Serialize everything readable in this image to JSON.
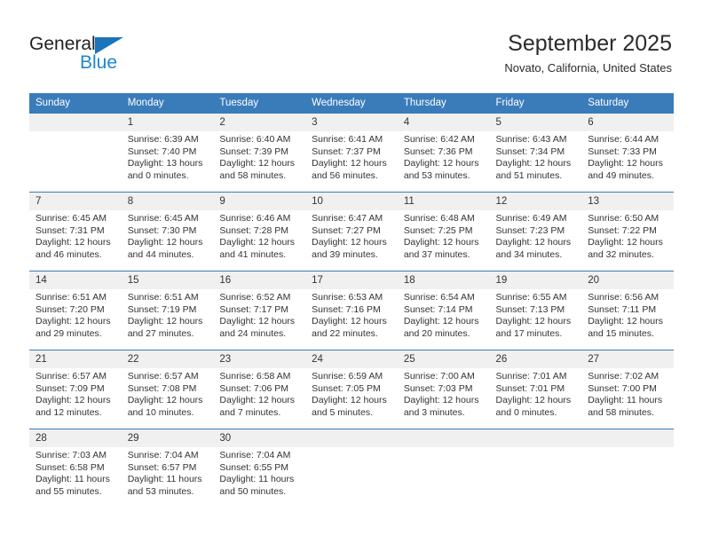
{
  "brand": {
    "name_top": "General",
    "name_bottom": "Blue",
    "color_primary": "#1b75bb",
    "color_secondary": "#1b87d2"
  },
  "header": {
    "title": "September 2025",
    "subtitle": "Novato, California, United States"
  },
  "theme": {
    "header_row_bg": "#3a7cba",
    "daynum_bg": "#f0f0f0",
    "text": "#333333"
  },
  "weekday_headers": [
    "Sunday",
    "Monday",
    "Tuesday",
    "Wednesday",
    "Thursday",
    "Friday",
    "Saturday"
  ],
  "weeks": [
    [
      {
        "day": "",
        "empty": true,
        "sunrise": "",
        "sunset": "",
        "daylight1": "",
        "daylight2": ""
      },
      {
        "day": "1",
        "sunrise": "Sunrise: 6:39 AM",
        "sunset": "Sunset: 7:40 PM",
        "daylight1": "Daylight: 13 hours",
        "daylight2": "and 0 minutes."
      },
      {
        "day": "2",
        "sunrise": "Sunrise: 6:40 AM",
        "sunset": "Sunset: 7:39 PM",
        "daylight1": "Daylight: 12 hours",
        "daylight2": "and 58 minutes."
      },
      {
        "day": "3",
        "sunrise": "Sunrise: 6:41 AM",
        "sunset": "Sunset: 7:37 PM",
        "daylight1": "Daylight: 12 hours",
        "daylight2": "and 56 minutes."
      },
      {
        "day": "4",
        "sunrise": "Sunrise: 6:42 AM",
        "sunset": "Sunset: 7:36 PM",
        "daylight1": "Daylight: 12 hours",
        "daylight2": "and 53 minutes."
      },
      {
        "day": "5",
        "sunrise": "Sunrise: 6:43 AM",
        "sunset": "Sunset: 7:34 PM",
        "daylight1": "Daylight: 12 hours",
        "daylight2": "and 51 minutes."
      },
      {
        "day": "6",
        "sunrise": "Sunrise: 6:44 AM",
        "sunset": "Sunset: 7:33 PM",
        "daylight1": "Daylight: 12 hours",
        "daylight2": "and 49 minutes."
      }
    ],
    [
      {
        "day": "7",
        "sunrise": "Sunrise: 6:45 AM",
        "sunset": "Sunset: 7:31 PM",
        "daylight1": "Daylight: 12 hours",
        "daylight2": "and 46 minutes."
      },
      {
        "day": "8",
        "sunrise": "Sunrise: 6:45 AM",
        "sunset": "Sunset: 7:30 PM",
        "daylight1": "Daylight: 12 hours",
        "daylight2": "and 44 minutes."
      },
      {
        "day": "9",
        "sunrise": "Sunrise: 6:46 AM",
        "sunset": "Sunset: 7:28 PM",
        "daylight1": "Daylight: 12 hours",
        "daylight2": "and 41 minutes."
      },
      {
        "day": "10",
        "sunrise": "Sunrise: 6:47 AM",
        "sunset": "Sunset: 7:27 PM",
        "daylight1": "Daylight: 12 hours",
        "daylight2": "and 39 minutes."
      },
      {
        "day": "11",
        "sunrise": "Sunrise: 6:48 AM",
        "sunset": "Sunset: 7:25 PM",
        "daylight1": "Daylight: 12 hours",
        "daylight2": "and 37 minutes."
      },
      {
        "day": "12",
        "sunrise": "Sunrise: 6:49 AM",
        "sunset": "Sunset: 7:23 PM",
        "daylight1": "Daylight: 12 hours",
        "daylight2": "and 34 minutes."
      },
      {
        "day": "13",
        "sunrise": "Sunrise: 6:50 AM",
        "sunset": "Sunset: 7:22 PM",
        "daylight1": "Daylight: 12 hours",
        "daylight2": "and 32 minutes."
      }
    ],
    [
      {
        "day": "14",
        "sunrise": "Sunrise: 6:51 AM",
        "sunset": "Sunset: 7:20 PM",
        "daylight1": "Daylight: 12 hours",
        "daylight2": "and 29 minutes."
      },
      {
        "day": "15",
        "sunrise": "Sunrise: 6:51 AM",
        "sunset": "Sunset: 7:19 PM",
        "daylight1": "Daylight: 12 hours",
        "daylight2": "and 27 minutes."
      },
      {
        "day": "16",
        "sunrise": "Sunrise: 6:52 AM",
        "sunset": "Sunset: 7:17 PM",
        "daylight1": "Daylight: 12 hours",
        "daylight2": "and 24 minutes."
      },
      {
        "day": "17",
        "sunrise": "Sunrise: 6:53 AM",
        "sunset": "Sunset: 7:16 PM",
        "daylight1": "Daylight: 12 hours",
        "daylight2": "and 22 minutes."
      },
      {
        "day": "18",
        "sunrise": "Sunrise: 6:54 AM",
        "sunset": "Sunset: 7:14 PM",
        "daylight1": "Daylight: 12 hours",
        "daylight2": "and 20 minutes."
      },
      {
        "day": "19",
        "sunrise": "Sunrise: 6:55 AM",
        "sunset": "Sunset: 7:13 PM",
        "daylight1": "Daylight: 12 hours",
        "daylight2": "and 17 minutes."
      },
      {
        "day": "20",
        "sunrise": "Sunrise: 6:56 AM",
        "sunset": "Sunset: 7:11 PM",
        "daylight1": "Daylight: 12 hours",
        "daylight2": "and 15 minutes."
      }
    ],
    [
      {
        "day": "21",
        "sunrise": "Sunrise: 6:57 AM",
        "sunset": "Sunset: 7:09 PM",
        "daylight1": "Daylight: 12 hours",
        "daylight2": "and 12 minutes."
      },
      {
        "day": "22",
        "sunrise": "Sunrise: 6:57 AM",
        "sunset": "Sunset: 7:08 PM",
        "daylight1": "Daylight: 12 hours",
        "daylight2": "and 10 minutes."
      },
      {
        "day": "23",
        "sunrise": "Sunrise: 6:58 AM",
        "sunset": "Sunset: 7:06 PM",
        "daylight1": "Daylight: 12 hours",
        "daylight2": "and 7 minutes."
      },
      {
        "day": "24",
        "sunrise": "Sunrise: 6:59 AM",
        "sunset": "Sunset: 7:05 PM",
        "daylight1": "Daylight: 12 hours",
        "daylight2": "and 5 minutes."
      },
      {
        "day": "25",
        "sunrise": "Sunrise: 7:00 AM",
        "sunset": "Sunset: 7:03 PM",
        "daylight1": "Daylight: 12 hours",
        "daylight2": "and 3 minutes."
      },
      {
        "day": "26",
        "sunrise": "Sunrise: 7:01 AM",
        "sunset": "Sunset: 7:01 PM",
        "daylight1": "Daylight: 12 hours",
        "daylight2": "and 0 minutes."
      },
      {
        "day": "27",
        "sunrise": "Sunrise: 7:02 AM",
        "sunset": "Sunset: 7:00 PM",
        "daylight1": "Daylight: 11 hours",
        "daylight2": "and 58 minutes."
      }
    ],
    [
      {
        "day": "28",
        "sunrise": "Sunrise: 7:03 AM",
        "sunset": "Sunset: 6:58 PM",
        "daylight1": "Daylight: 11 hours",
        "daylight2": "and 55 minutes."
      },
      {
        "day": "29",
        "sunrise": "Sunrise: 7:04 AM",
        "sunset": "Sunset: 6:57 PM",
        "daylight1": "Daylight: 11 hours",
        "daylight2": "and 53 minutes."
      },
      {
        "day": "30",
        "sunrise": "Sunrise: 7:04 AM",
        "sunset": "Sunset: 6:55 PM",
        "daylight1": "Daylight: 11 hours",
        "daylight2": "and 50 minutes."
      },
      {
        "day": "",
        "empty": true,
        "sunrise": "",
        "sunset": "",
        "daylight1": "",
        "daylight2": ""
      },
      {
        "day": "",
        "empty": true,
        "sunrise": "",
        "sunset": "",
        "daylight1": "",
        "daylight2": ""
      },
      {
        "day": "",
        "empty": true,
        "sunrise": "",
        "sunset": "",
        "daylight1": "",
        "daylight2": ""
      },
      {
        "day": "",
        "empty": true,
        "sunrise": "",
        "sunset": "",
        "daylight1": "",
        "daylight2": ""
      }
    ]
  ]
}
